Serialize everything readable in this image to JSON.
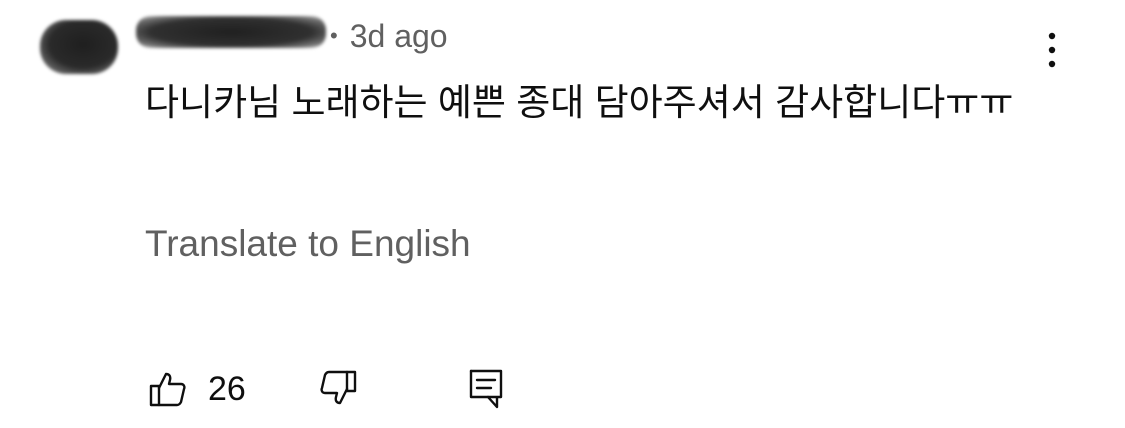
{
  "comment": {
    "timestamp": "3d ago",
    "separator": "•",
    "text": "다니카님 노래하는 예쁜 종대 담아주셔서 감사합니다ㅠㅠ",
    "translate_label": "Translate to English"
  },
  "actions": {
    "like_count": "26",
    "icons": {
      "like": "thumbs-up-icon",
      "dislike": "thumbs-down-icon",
      "reply": "reply-icon",
      "more": "more-vertical-icon"
    }
  }
}
